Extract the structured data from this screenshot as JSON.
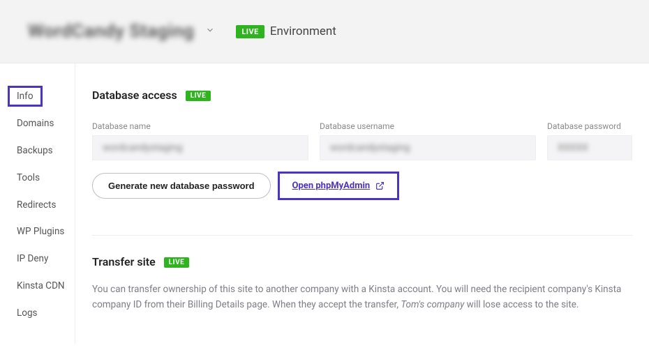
{
  "header": {
    "site_name": "WordCandy Staging",
    "live_badge": "LIVE",
    "env_label": "Environment"
  },
  "sidebar": {
    "items": [
      {
        "label": "Info"
      },
      {
        "label": "Domains"
      },
      {
        "label": "Backups"
      },
      {
        "label": "Tools"
      },
      {
        "label": "Redirects"
      },
      {
        "label": "WP Plugins"
      },
      {
        "label": "IP Deny"
      },
      {
        "label": "Kinsta CDN"
      },
      {
        "label": "Logs"
      }
    ]
  },
  "db_section": {
    "title": "Database access",
    "badge": "LIVE",
    "name_label": "Database name",
    "name_value": "wordcandystaging",
    "user_label": "Database username",
    "user_value": "wordcandystaging",
    "pass_label": "Database password",
    "pass_value": "XXXXX",
    "gen_btn": "Generate new database password",
    "open_btn": "Open phpMyAdmin"
  },
  "transfer_section": {
    "title": "Transfer site",
    "badge": "LIVE",
    "desc_1": "You can transfer ownership of this site to another company with a Kinsta account. You will need the recipient company's Kinsta company ID from their Billing Details page. When they accept the transfer, ",
    "desc_em": "Tom's company",
    "desc_2": " will lose access to the site."
  }
}
